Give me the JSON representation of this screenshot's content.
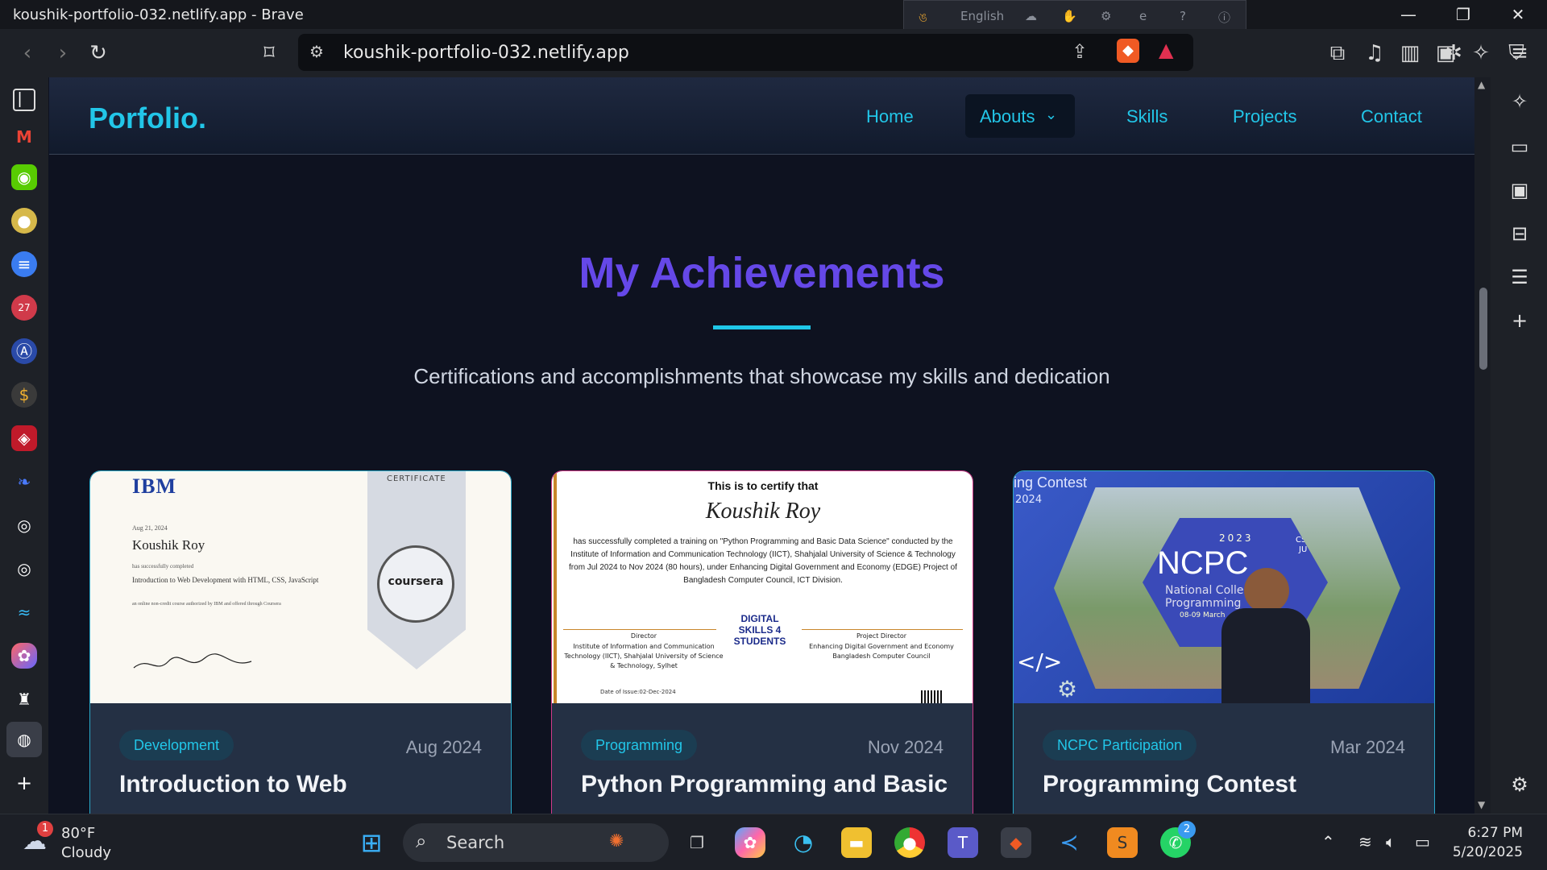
{
  "window": {
    "title": "koushik-portfolio-032.netlify.app - Brave"
  },
  "ime": {
    "language": "English"
  },
  "browser": {
    "url": "koushik-portfolio-032.netlify.app"
  },
  "site": {
    "brand": "Porfolio.",
    "nav": [
      "Home",
      "Abouts",
      "Skills",
      "Projects",
      "Contact"
    ],
    "heading": "My Achievements",
    "subtitle": "Certifications and accomplishments that showcase my skills and dedication",
    "cards": [
      {
        "tag": "Development",
        "date": "Aug 2024",
        "title": "Introduction to Web"
      },
      {
        "tag": "Programming",
        "date": "Nov 2024",
        "title": "Python Programming and Basic"
      },
      {
        "tag": "NCPC Participation",
        "date": "Mar 2024",
        "title": "Programming Contest"
      }
    ],
    "certificates": {
      "coursera": {
        "logo": "IBM",
        "header": "CERTIFICATE",
        "date_line": "Aug 21, 2024",
        "name": "Koushik Roy",
        "completed": "has successfully completed",
        "course": "Introduction to Web Development with HTML, CSS, JavaScript",
        "note": "an online non-credit course authorized by IBM and offered through Coursera",
        "seal": "coursera"
      },
      "python": {
        "line1": "This is to certify that",
        "name": "Koushik Roy",
        "body": "has successfully completed a training on \"Python Programming and Basic Data Science\" conducted by the Institute of Information and Communication Technology (IICT), Shahjalal University of Science & Technology from Jul 2024 to Nov 2024 (80 hours), under Enhancing Digital Government and Economy (EDGE) Project of Bangladesh Computer Council, ICT Division.",
        "sig_left_title": "Director",
        "sig_left_org": "Institute of Information and Communication Technology (IICT), Shahjalal University of Science & Technology, Sylhet",
        "logo": "DIGITAL SKILLS 4 STUDENTS",
        "sig_right_title": "Project Director",
        "sig_right_org": "Enhancing Digital Government and Economy Bangladesh Computer Council",
        "issue_date": "Date of Issue:02-Dec-2024"
      },
      "ncpc": {
        "banner_top": "ing Contest",
        "banner_year": "2024",
        "sign_main": "NCPC",
        "sign_year": "2023",
        "sign_sub": "National College",
        "sign_sub2": "Programming",
        "sign_dates": "08-09 March",
        "sign_cse": "CSE",
        "sign_ju": "JU"
      }
    }
  },
  "taskbar": {
    "weather_temp": "80°F",
    "weather_desc": "Cloudy",
    "weather_badge": "1",
    "search": "Search",
    "whatsapp_badge": "2",
    "time": "6:27 PM",
    "date": "5/20/2025"
  },
  "colors": {
    "accent": "#22c6e8",
    "heading": "#6548e8",
    "card": "#243044",
    "background": "#0e1220"
  }
}
